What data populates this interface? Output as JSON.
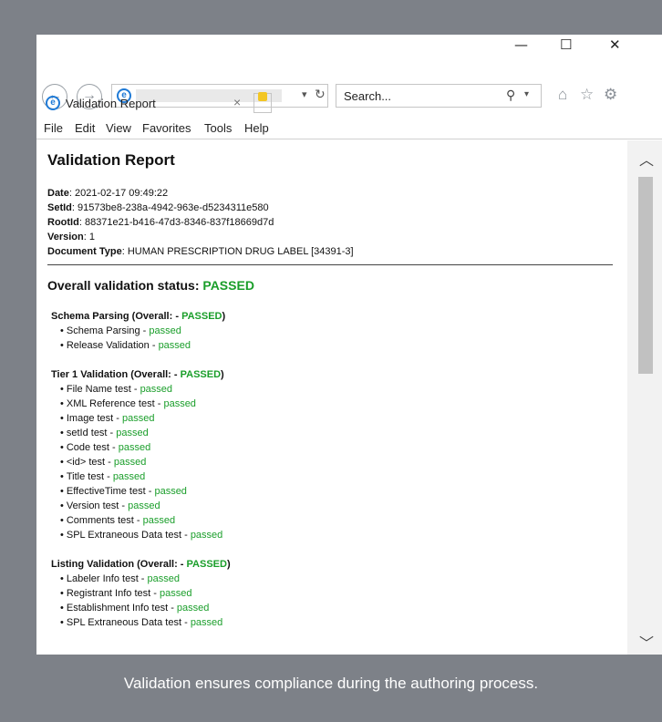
{
  "browser": {
    "search_placeholder": "Search...",
    "tab_label": "Validation Report",
    "menu": [
      "File",
      "Edit",
      "View",
      "Favorites",
      "Tools",
      "Help"
    ]
  },
  "report": {
    "title": "Validation Report",
    "meta": [
      {
        "label": "Date",
        "value": "2021-02-17 09:49:22"
      },
      {
        "label": "SetId",
        "value": "91573be8-238a-4942-963e-d5234311e580"
      },
      {
        "label": "RootId",
        "value": "88371e21-b416-47d3-8346-837f18669d7d"
      },
      {
        "label": "Version",
        "value": "1"
      },
      {
        "label": "Document Type",
        "value": "HUMAN PRESCRIPTION DRUG LABEL [34391-3]"
      }
    ],
    "overall_label": "Overall validation status:",
    "overall_status": "PASSED",
    "sections": [
      {
        "title": "Schema Parsing (Overall: - ",
        "status": "PASSED",
        "items": [
          {
            "name": "Schema Parsing",
            "result": "passed"
          },
          {
            "name": "Release Validation",
            "result": "passed"
          }
        ]
      },
      {
        "title": "Tier 1 Validation (Overall: - ",
        "status": "PASSED",
        "items": [
          {
            "name": "File Name test",
            "result": "passed"
          },
          {
            "name": "XML Reference test",
            "result": "passed"
          },
          {
            "name": "Image test",
            "result": "passed"
          },
          {
            "name": "setId test",
            "result": "passed"
          },
          {
            "name": "Code test",
            "result": "passed"
          },
          {
            "name": "<id> test",
            "result": "passed"
          },
          {
            "name": "Title test",
            "result": "passed"
          },
          {
            "name": "EffectiveTime test",
            "result": "passed"
          },
          {
            "name": "Version test",
            "result": "passed"
          },
          {
            "name": "Comments test",
            "result": "passed"
          },
          {
            "name": "SPL Extraneous Data test",
            "result": "passed"
          }
        ]
      },
      {
        "title": "Listing Validation (Overall: - ",
        "status": "PASSED",
        "items": [
          {
            "name": "Labeler Info test",
            "result": "passed"
          },
          {
            "name": "Registrant Info test",
            "result": "passed"
          },
          {
            "name": "Establishment Info test",
            "result": "passed"
          },
          {
            "name": "SPL Extraneous Data test",
            "result": "passed"
          }
        ]
      }
    ]
  },
  "caption": "Validation ensures compliance during the authoring process.",
  "colors": {
    "status_green": "#1a9e2a",
    "frame_gray": "#7d8188"
  }
}
